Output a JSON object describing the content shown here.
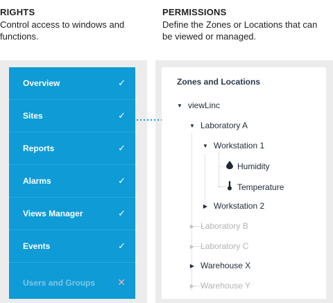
{
  "rights": {
    "heading": "RIGHTS",
    "description": "Control access to windows and functions.",
    "items": [
      {
        "label": "Overview",
        "mark": "✓"
      },
      {
        "label": "Sites",
        "mark": "✓"
      },
      {
        "label": "Reports",
        "mark": "✓"
      },
      {
        "label": "Alarms",
        "mark": "✓"
      },
      {
        "label": "Views Manager",
        "mark": "✓"
      },
      {
        "label": "Events",
        "mark": "✓"
      },
      {
        "label": "Users and Groups",
        "mark": "✕"
      }
    ]
  },
  "permissions": {
    "heading": "PERMISSIONS",
    "description": "Define the Zones or Locations that can be viewed or managed.",
    "panel_title": "Zones and Locations",
    "tree": [
      {
        "label": "viewLinc",
        "caret": "▼"
      },
      {
        "label": "Laboratory A",
        "caret": "▼"
      },
      {
        "label": "Workstation 1",
        "caret": "▼"
      },
      {
        "label": "Humidity",
        "icon": "💧"
      },
      {
        "label": "Temperature",
        "icon": "🌡"
      },
      {
        "label": "Workstation 2",
        "caret": "▶"
      },
      {
        "label": "Laboratory B",
        "caret": "▶"
      },
      {
        "label": "Laboratory C",
        "caret": "▶"
      },
      {
        "label": "Warehouse X",
        "caret": "▶"
      },
      {
        "label": "Warehouse Y",
        "caret": "▶"
      }
    ]
  },
  "colors": {
    "rights_blue": "#0e9bd6",
    "panel_grey": "#ececec",
    "disabled_text": "#7fc6e6",
    "disabled_mark": "#f2b3b3",
    "tree_disabled": "#b3b3b3"
  }
}
